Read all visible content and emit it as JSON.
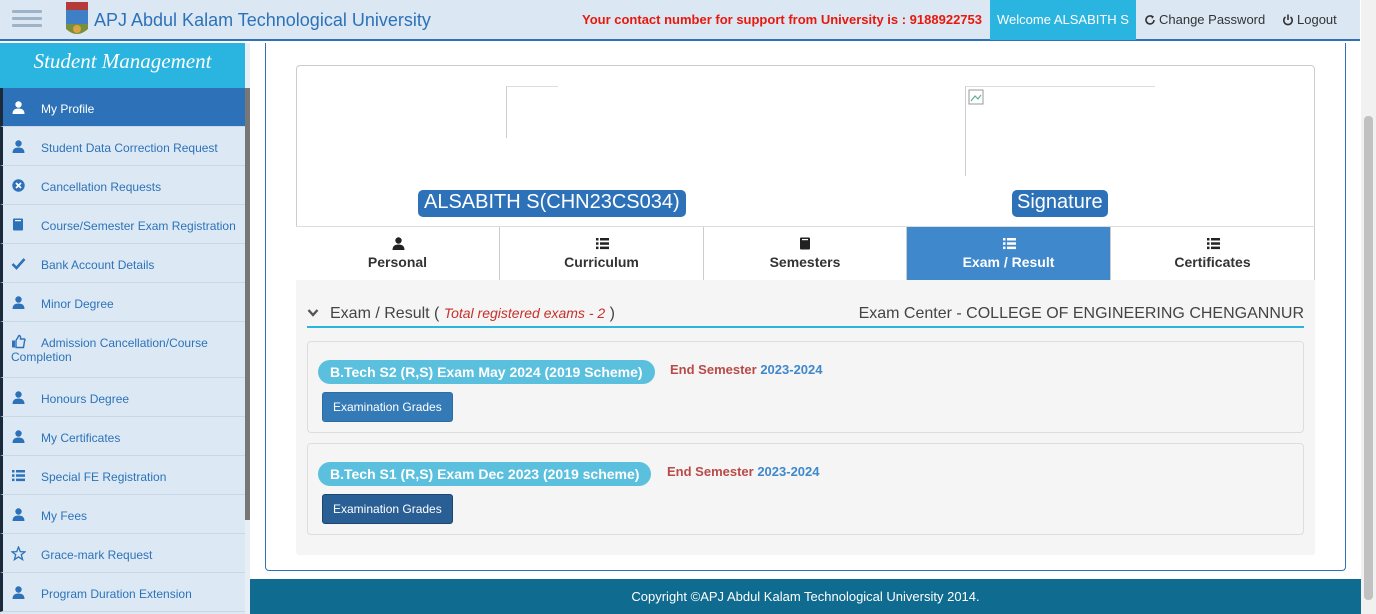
{
  "header": {
    "brand": "APJ Abdul Kalam Technological University",
    "support": "Your contact number for support from University is : 9188922753",
    "welcome": "Welcome ALSABITH S",
    "change_password": "Change Password",
    "logout": "Logout"
  },
  "sidebar": {
    "title": "Student Management",
    "items": [
      {
        "label": "My Profile",
        "icon": "user-icon"
      },
      {
        "label": "Student Data Correction Request",
        "icon": "user-icon"
      },
      {
        "label": "Cancellation Requests",
        "icon": "remove-circle-icon"
      },
      {
        "label": "Course/Semester Exam Registration",
        "icon": "book-icon"
      },
      {
        "label": "Bank Account Details",
        "icon": "check-icon"
      },
      {
        "label": "Minor Degree",
        "icon": "user-icon"
      },
      {
        "label": "Admission Cancellation/Course Completion",
        "icon": "thumbs-up-icon"
      },
      {
        "label": "Honours Degree",
        "icon": "user-icon"
      },
      {
        "label": "My Certificates",
        "icon": "user-icon"
      },
      {
        "label": "Special FE Registration",
        "icon": "list-icon"
      },
      {
        "label": "My Fees",
        "icon": "user-icon"
      },
      {
        "label": "Grace-mark Request",
        "icon": "star-icon"
      },
      {
        "label": "Program Duration Extension",
        "icon": "user-icon"
      }
    ]
  },
  "profile": {
    "name": "ALSABITH S(CHN23CS034)",
    "signature_label": "Signature"
  },
  "tabs": [
    {
      "label": "Personal",
      "icon": "user-icon"
    },
    {
      "label": "Curriculum",
      "icon": "list-icon"
    },
    {
      "label": "Semesters",
      "icon": "book-icon"
    },
    {
      "label": "Exam / Result",
      "icon": "list-icon"
    },
    {
      "label": "Certificates",
      "icon": "list-icon"
    }
  ],
  "exam": {
    "title": "Exam / Result",
    "paren_open": "(",
    "total": "Total registered exams - 2",
    "paren_close": ")",
    "center": "Exam Center - COLLEGE OF ENGINEERING CHENGANNUR",
    "list": [
      {
        "name": "B.Tech S2 (R,S) Exam May 2024 (2019 Scheme)",
        "end_label": "End Semester",
        "year": "2023-2024",
        "button": "Examination Grades"
      },
      {
        "name": "B.Tech S1 (R,S) Exam Dec 2023 (2019 scheme)",
        "end_label": "End Semester",
        "year": "2023-2024",
        "button": "Examination Grades"
      }
    ]
  },
  "footer": {
    "text": "Copyright ©APJ Abdul Kalam Technological University 2014."
  },
  "colors": {
    "primary": "#2d72b8",
    "accent": "#29b5e0",
    "alert": "#e8180c",
    "footer": "#0f6b8f"
  }
}
